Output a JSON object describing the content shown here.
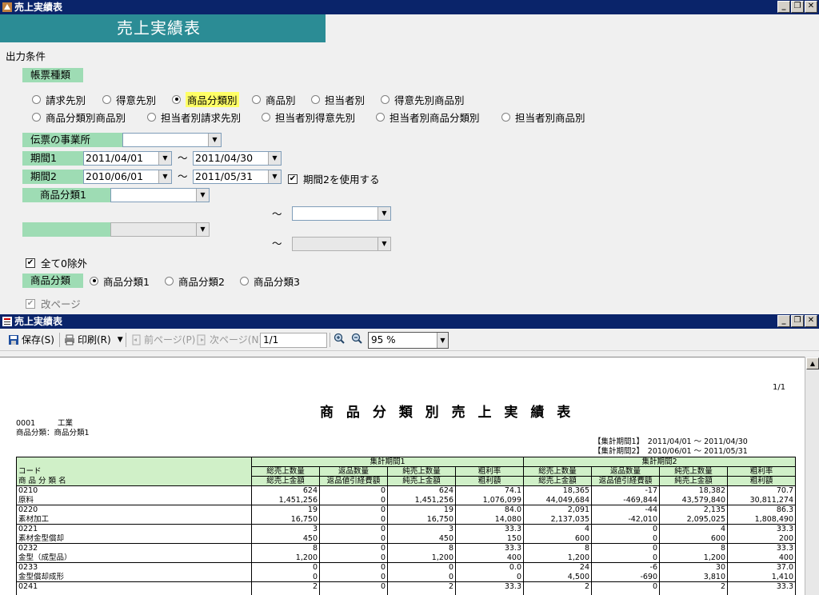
{
  "main_window": {
    "title": "売上実績表"
  },
  "banner": {
    "title": "売上実績表"
  },
  "conditions": {
    "heading": "出力条件",
    "report_type": {
      "label": "帳票種類",
      "options": [
        "請求先別",
        "得意先別",
        "商品分類別",
        "商品別",
        "担当者別",
        "得意先別商品別",
        "商品分類別商品別",
        "担当者別請求先別",
        "担当者別得意先別",
        "担当者別商品分類別",
        "担当者別商品別"
      ],
      "selected": "商品分類別"
    },
    "office": {
      "label": "伝票の事業所",
      "value": ""
    },
    "period1": {
      "label": "期間1",
      "from": "2011/04/01",
      "to": "2011/04/30"
    },
    "period2": {
      "label": "期間2",
      "from": "2010/06/01",
      "to": "2011/05/31",
      "use_label": "期間2を使用する",
      "use": true
    },
    "category1": {
      "label": "商品分類1",
      "from": "",
      "to": ""
    },
    "tilde": "～",
    "exclude_zero": {
      "label": "全て0除外",
      "checked": true
    },
    "category_level": {
      "label": "商品分類",
      "options": [
        "商品分類1",
        "商品分類2",
        "商品分類3"
      ],
      "selected": "商品分類1"
    },
    "page_break": {
      "label": "改ページ",
      "checked": true
    }
  },
  "preview_window": {
    "title": "売上実績表",
    "toolbar": {
      "save": "保存(S)",
      "print": "印刷(R)",
      "prev": "前ページ(P)",
      "next": "次ページ(N)",
      "page": "1/1",
      "zoom": "95 %"
    }
  },
  "report": {
    "page": "1/1",
    "title": "商 品 分 類 別 売 上 実 績 表",
    "company_code": "0001",
    "company_name": "工業",
    "category_line": "商品分類：商品分類1",
    "period1_line": "【集計期間1】　2011/04/01 ～ 2011/04/30",
    "period2_line": "【集計期間2】　2010/06/01 ～ 2011/05/31",
    "col_code": "コード",
    "col_name": "商 品 分 類 名",
    "group1": "集計期間1",
    "group2": "集計期間2",
    "sub_top": [
      "総売上数量",
      "返品数量",
      "純売上数量",
      "粗利率"
    ],
    "sub_bot": [
      "総売上金額",
      "返品値引経費額",
      "純売上金額",
      "粗利額"
    ],
    "rows": [
      {
        "code": "0210",
        "name": "原料",
        "top": [
          "624",
          "0",
          "624",
          "74.1",
          "18,365",
          "-17",
          "18,382",
          "70.7"
        ],
        "bot": [
          "1,451,256",
          "0",
          "1,451,256",
          "1,076,099",
          "44,049,684",
          "-469,844",
          "43,579,840",
          "30,811,274"
        ]
      },
      {
        "code": "0220",
        "name": "素材加工",
        "top": [
          "19",
          "0",
          "19",
          "84.0",
          "2,091",
          "-44",
          "2,135",
          "86.3"
        ],
        "bot": [
          "16,750",
          "0",
          "16,750",
          "14,080",
          "2,137,035",
          "-42,010",
          "2,095,025",
          "1,808,490"
        ]
      },
      {
        "code": "0221",
        "name": "素材金型償却",
        "top": [
          "3",
          "0",
          "3",
          "33.3",
          "4",
          "0",
          "4",
          "33.3"
        ],
        "bot": [
          "450",
          "0",
          "450",
          "150",
          "600",
          "0",
          "600",
          "200"
        ]
      },
      {
        "code": "0232",
        "name": "金型（成型品）",
        "top": [
          "8",
          "0",
          "8",
          "33.3",
          "8",
          "0",
          "8",
          "33.3"
        ],
        "bot": [
          "1,200",
          "0",
          "1,200",
          "400",
          "1,200",
          "0",
          "1,200",
          "400"
        ]
      },
      {
        "code": "0233",
        "name": "金型償却成形",
        "top": [
          "0",
          "0",
          "0",
          "0.0",
          "24",
          "-6",
          "30",
          "37.0"
        ],
        "bot": [
          "0",
          "0",
          "0",
          "0",
          "4,500",
          "-690",
          "3,810",
          "1,410"
        ]
      },
      {
        "code": "0241",
        "name": "",
        "top": [
          "2",
          "0",
          "2",
          "33.3",
          "2",
          "0",
          "2",
          "33.3"
        ],
        "bot": [
          "",
          "",
          "",
          "",
          "",
          "",
          "",
          ""
        ]
      }
    ]
  }
}
